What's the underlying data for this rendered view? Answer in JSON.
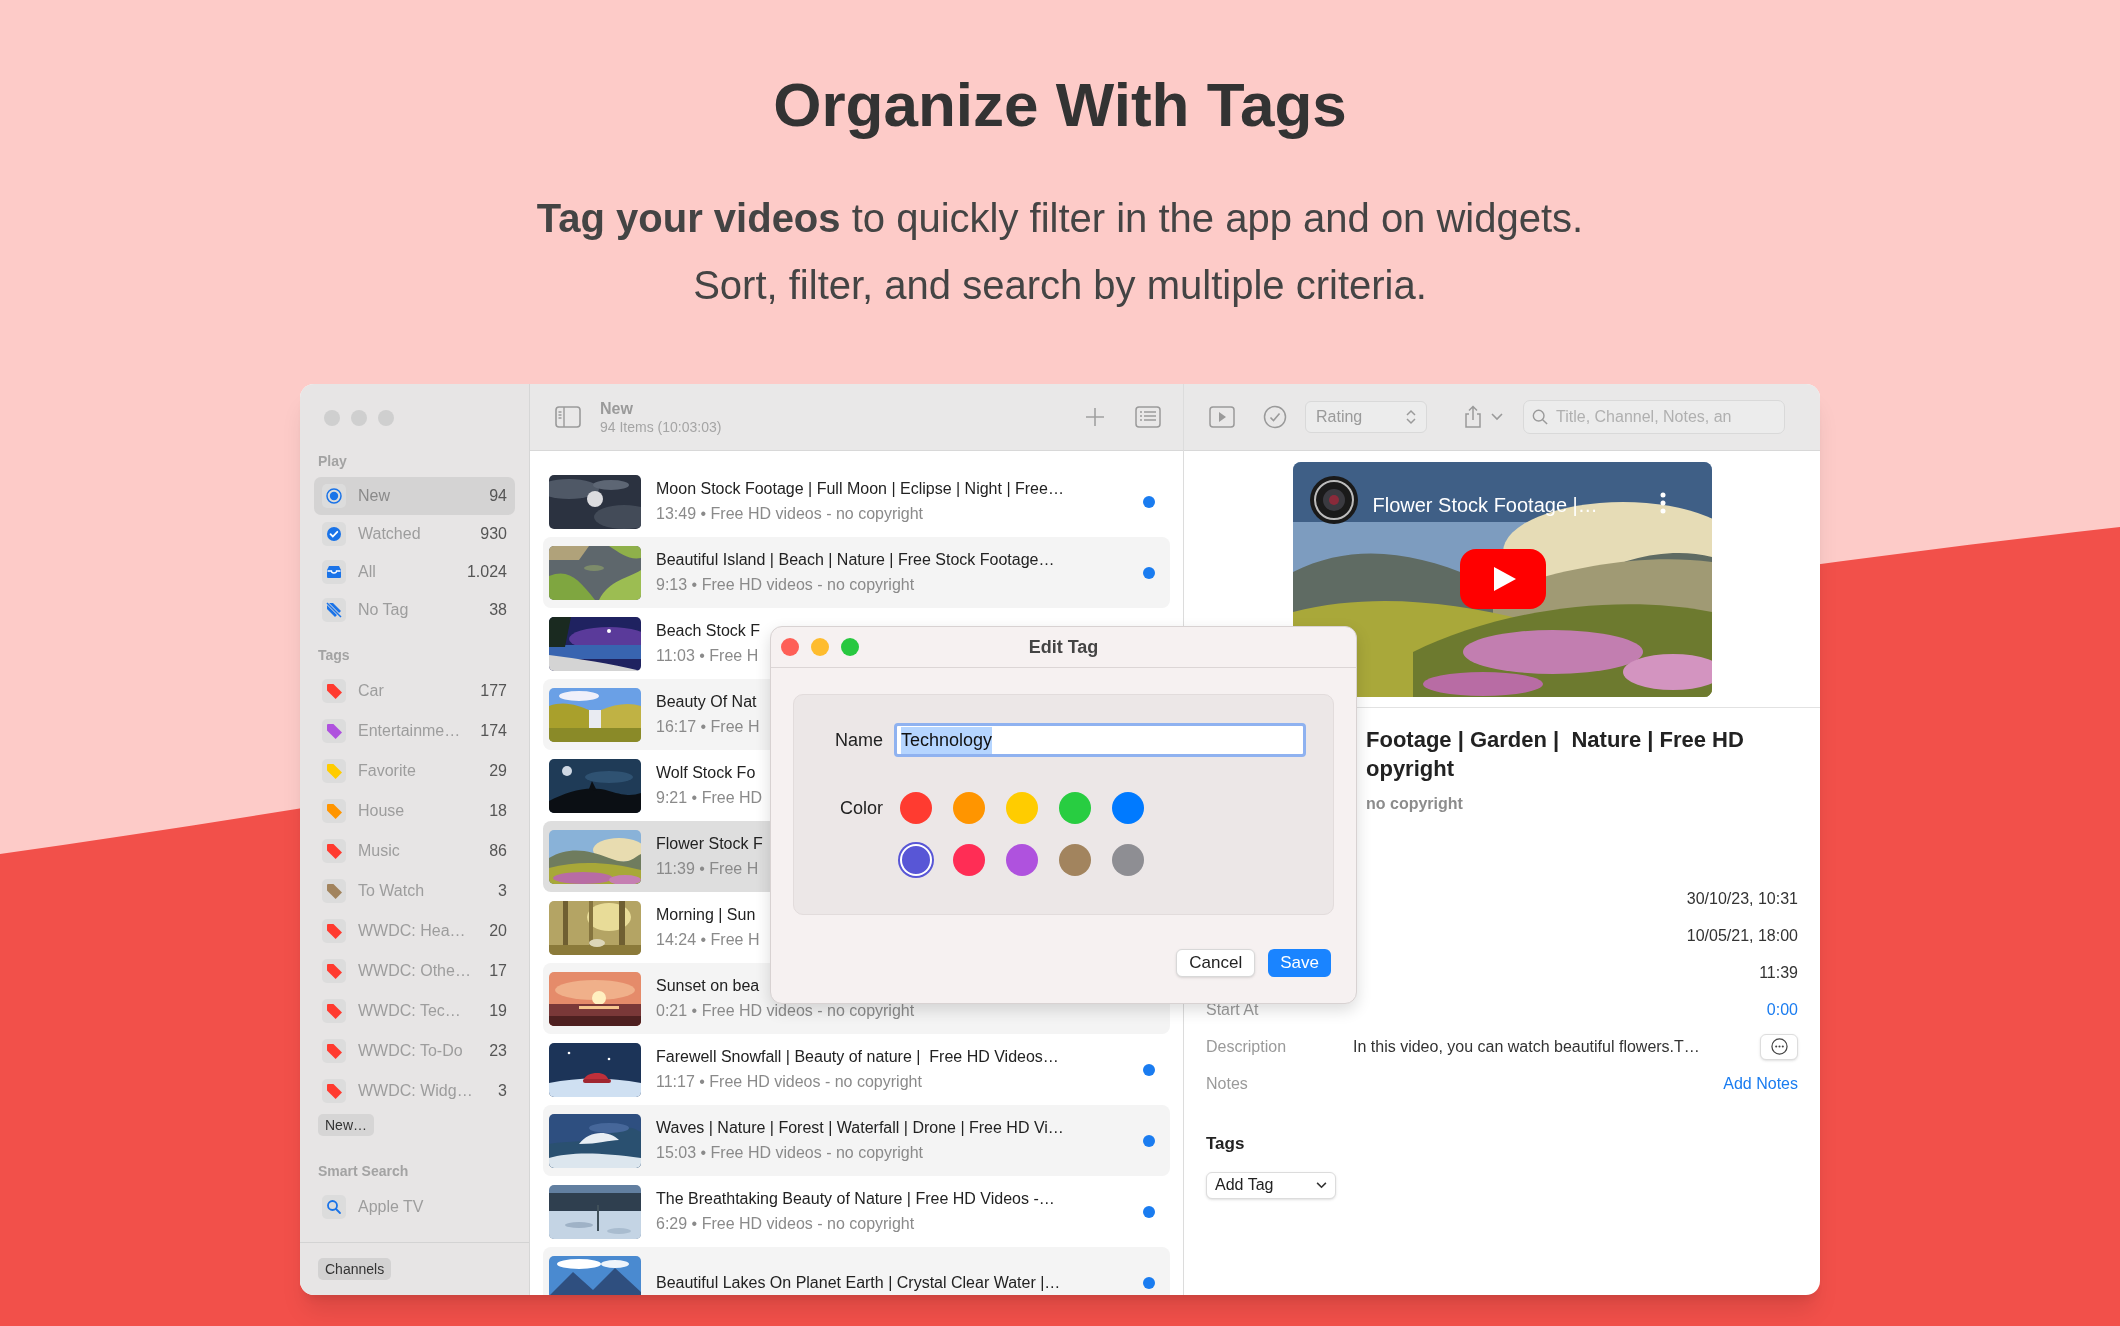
{
  "hero": {
    "title": "Organize With Tags",
    "subtitle_lines": [
      "**Tag your videos** to quickly filter in the app and on widgets.",
      "Sort, filter, and search by multiple criteria."
    ]
  },
  "sidebar": {
    "sections": [
      {
        "kind": "play",
        "header": "Play",
        "items": [
          {
            "label": "New",
            "count": "94",
            "selected": true
          },
          {
            "label": "Watched",
            "count": "930",
            "selected": false
          },
          {
            "label": "All",
            "count": "1.024",
            "selected": false
          },
          {
            "label": "No Tag",
            "count": "38",
            "selected": false
          }
        ]
      },
      {
        "kind": "tags",
        "header": "Tags",
        "new_button": "New…",
        "items": [
          {
            "label": "Car",
            "count": "177",
            "color": "#ff3b30",
            "selected": false
          },
          {
            "label": "Entertainme…",
            "count": "174",
            "color": "#af52de",
            "selected": false
          },
          {
            "label": "Favorite",
            "count": "29",
            "color": "#ffcc00",
            "selected": false
          },
          {
            "label": "House",
            "count": "18",
            "color": "#ff9500",
            "selected": false
          },
          {
            "label": "Music",
            "count": "86",
            "color": "#ff3b30",
            "selected": false
          },
          {
            "label": "To Watch",
            "count": "3",
            "color": "#a2845e",
            "selected": false
          },
          {
            "label": "WWDC: Hea…",
            "count": "20",
            "color": "#ff3b30",
            "selected": false
          },
          {
            "label": "WWDC: Othe…",
            "count": "17",
            "color": "#ff3b30",
            "selected": false
          },
          {
            "label": "WWDC: Tec…",
            "count": "19",
            "color": "#ff3b30",
            "selected": false
          },
          {
            "label": "WWDC: To-Do",
            "count": "23",
            "color": "#ff3b30",
            "selected": false
          },
          {
            "label": "WWDC: Widg…",
            "count": "3",
            "color": "#ff3b30",
            "selected": false
          }
        ]
      },
      {
        "kind": "smart",
        "header": "Smart Search",
        "items": [
          {
            "label": "Apple TV",
            "selected": false
          }
        ]
      }
    ],
    "footer_button": "Channels"
  },
  "list": {
    "title": "New",
    "subtitle": "94 Items (10:03:03)",
    "rows": [
      {
        "title": "Moon Stock Footage | Full Moon | Eclipse | Night | Free…",
        "subtitle": "13:49 • Free HD videos - no copyright",
        "selected": false,
        "unwatched": true
      },
      {
        "title": "Beautiful Island | Beach | Nature | Free Stock Footage…",
        "subtitle": "9:13 • Free HD videos - no copyright",
        "selected": false,
        "unwatched": true
      },
      {
        "title": "Beach Stock F",
        "subtitle": "11:03 • Free H",
        "selected": false
      },
      {
        "title": "Beauty Of Nat",
        "subtitle": "16:17 • Free H",
        "selected": false
      },
      {
        "title": "Wolf Stock Fo",
        "subtitle": "9:21 • Free HD",
        "selected": false
      },
      {
        "title": "Flower Stock F",
        "subtitle": "11:39 • Free H",
        "selected": true
      },
      {
        "title": "Morning | Sun",
        "subtitle": "14:24 • Free H",
        "selected": false
      },
      {
        "title": "Sunset on bea",
        "subtitle": "0:21 • Free HD videos - no copyright",
        "selected": false
      },
      {
        "title": "Farewell Snowfall | Beauty of nature |  Free HD Videos…",
        "subtitle": "11:17 • Free HD videos - no copyright",
        "selected": false,
        "unwatched": true
      },
      {
        "title": "Waves | Nature | Forest | Waterfall | Drone | Free HD Vi…",
        "subtitle": "15:03 • Free HD videos - no copyright",
        "selected": false,
        "unwatched": true
      },
      {
        "title": "The Breathtaking Beauty of Nature | Free HD Videos -…",
        "subtitle": "6:29 • Free HD videos - no copyright",
        "selected": false,
        "unwatched": true
      },
      {
        "title": "Beautiful Lakes On Planet Earth | Crystal Clear Water |…",
        "selected": false,
        "unwatched": true
      }
    ]
  },
  "toolbar": {
    "rating_label": "Rating",
    "search_placeholder": "Title, Channel, Notes, an"
  },
  "detail": {
    "video_overlay_title": "Flower Stock Footage |…",
    "title_lines": [
      "Footage | Garden |  Nature | Free HD",
      "opyright"
    ],
    "channel": "no copyright",
    "fields": [
      {
        "kind": "text",
        "value": "30/10/23, 10:31"
      },
      {
        "kind": "text",
        "value": "10/05/21, 18:00"
      },
      {
        "kind": "text",
        "value": "11:39"
      },
      {
        "kind": "link",
        "label": "Start At",
        "value": "0:00"
      },
      {
        "kind": "expandable",
        "label": "Description",
        "value": "In this video, you can watch beautiful flowers.T…"
      },
      {
        "kind": "link",
        "label": "Notes",
        "value": "Add Notes"
      }
    ],
    "tags_header": "Tags",
    "add_tag": "Add Tag"
  },
  "dialog": {
    "title": "Edit Tag",
    "name_label": "Name",
    "name_value": "Technology",
    "name_text_selected": true,
    "color_label": "Color",
    "colors": [
      {
        "color": "#ff3b30",
        "selected": false
      },
      {
        "color": "#ff9500",
        "selected": false
      },
      {
        "color": "#ffcc00",
        "selected": false
      },
      {
        "color": "#28cd41",
        "selected": false
      },
      {
        "color": "#007aff",
        "selected": false
      },
      {
        "color": "#5856d6",
        "selected": true
      },
      {
        "color": "#ff2d55",
        "selected": false
      },
      {
        "color": "#af52de",
        "selected": false
      },
      {
        "color": "#a2845e",
        "selected": false
      },
      {
        "color": "#8e8e93",
        "selected": false
      }
    ],
    "buttons": [
      {
        "kind": "secondary",
        "label": "Cancel"
      },
      {
        "kind": "primary",
        "label": "Save"
      }
    ]
  }
}
